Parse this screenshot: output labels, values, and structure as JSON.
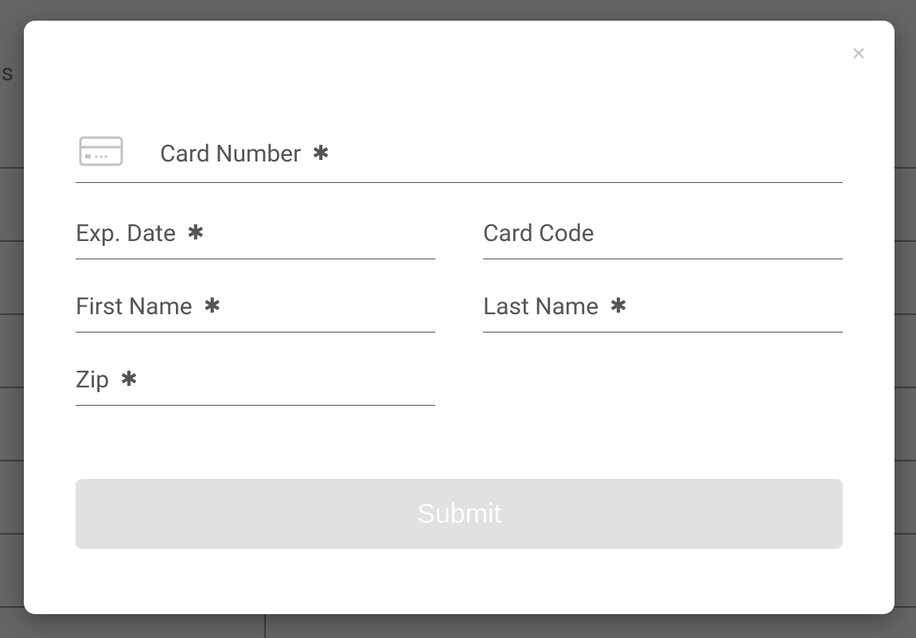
{
  "bg": {
    "partial_text": "ss"
  },
  "modal": {
    "close_label": "Close",
    "fields": {
      "card_number": {
        "label": "Card Number",
        "required": true,
        "value": ""
      },
      "exp_date": {
        "label": "Exp. Date",
        "required": true,
        "value": ""
      },
      "card_code": {
        "label": "Card Code",
        "required": false,
        "value": ""
      },
      "first_name": {
        "label": "First Name",
        "required": true,
        "value": ""
      },
      "last_name": {
        "label": "Last Name",
        "required": true,
        "value": ""
      },
      "zip": {
        "label": "Zip",
        "required": true,
        "value": ""
      }
    },
    "submit_label": "Submit"
  },
  "icons": {
    "required": "✱",
    "close": "×"
  }
}
